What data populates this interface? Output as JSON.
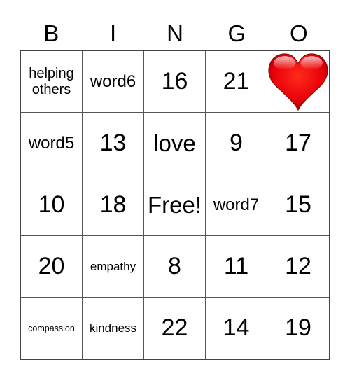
{
  "header": {
    "letters": [
      "B",
      "I",
      "N",
      "G",
      "O"
    ]
  },
  "board": {
    "rows": [
      [
        {
          "text": "helping others",
          "size": "two"
        },
        {
          "text": "word6",
          "size": "word"
        },
        {
          "text": "16",
          "size": "num"
        },
        {
          "text": "21",
          "size": "num"
        },
        {
          "text": "",
          "icon": "heart-icon"
        }
      ],
      [
        {
          "text": "word5",
          "size": "word"
        },
        {
          "text": "13",
          "size": "num"
        },
        {
          "text": "love",
          "size": "big"
        },
        {
          "text": "9",
          "size": "num"
        },
        {
          "text": "17",
          "size": "num"
        }
      ],
      [
        {
          "text": "10",
          "size": "num"
        },
        {
          "text": "18",
          "size": "num"
        },
        {
          "text": "Free!",
          "size": "big"
        },
        {
          "text": "word7",
          "size": "word"
        },
        {
          "text": "15",
          "size": "num"
        }
      ],
      [
        {
          "text": "20",
          "size": "num"
        },
        {
          "text": "empathy",
          "size": "med"
        },
        {
          "text": "8",
          "size": "num"
        },
        {
          "text": "11",
          "size": "num"
        },
        {
          "text": "12",
          "size": "num"
        }
      ],
      [
        {
          "text": "compassion",
          "size": "sm"
        },
        {
          "text": "kindness",
          "size": "med"
        },
        {
          "text": "22",
          "size": "num"
        },
        {
          "text": "14",
          "size": "num"
        },
        {
          "text": "19",
          "size": "num"
        }
      ]
    ]
  },
  "colors": {
    "heart": "#e8000a",
    "grid_line": "#555555"
  }
}
